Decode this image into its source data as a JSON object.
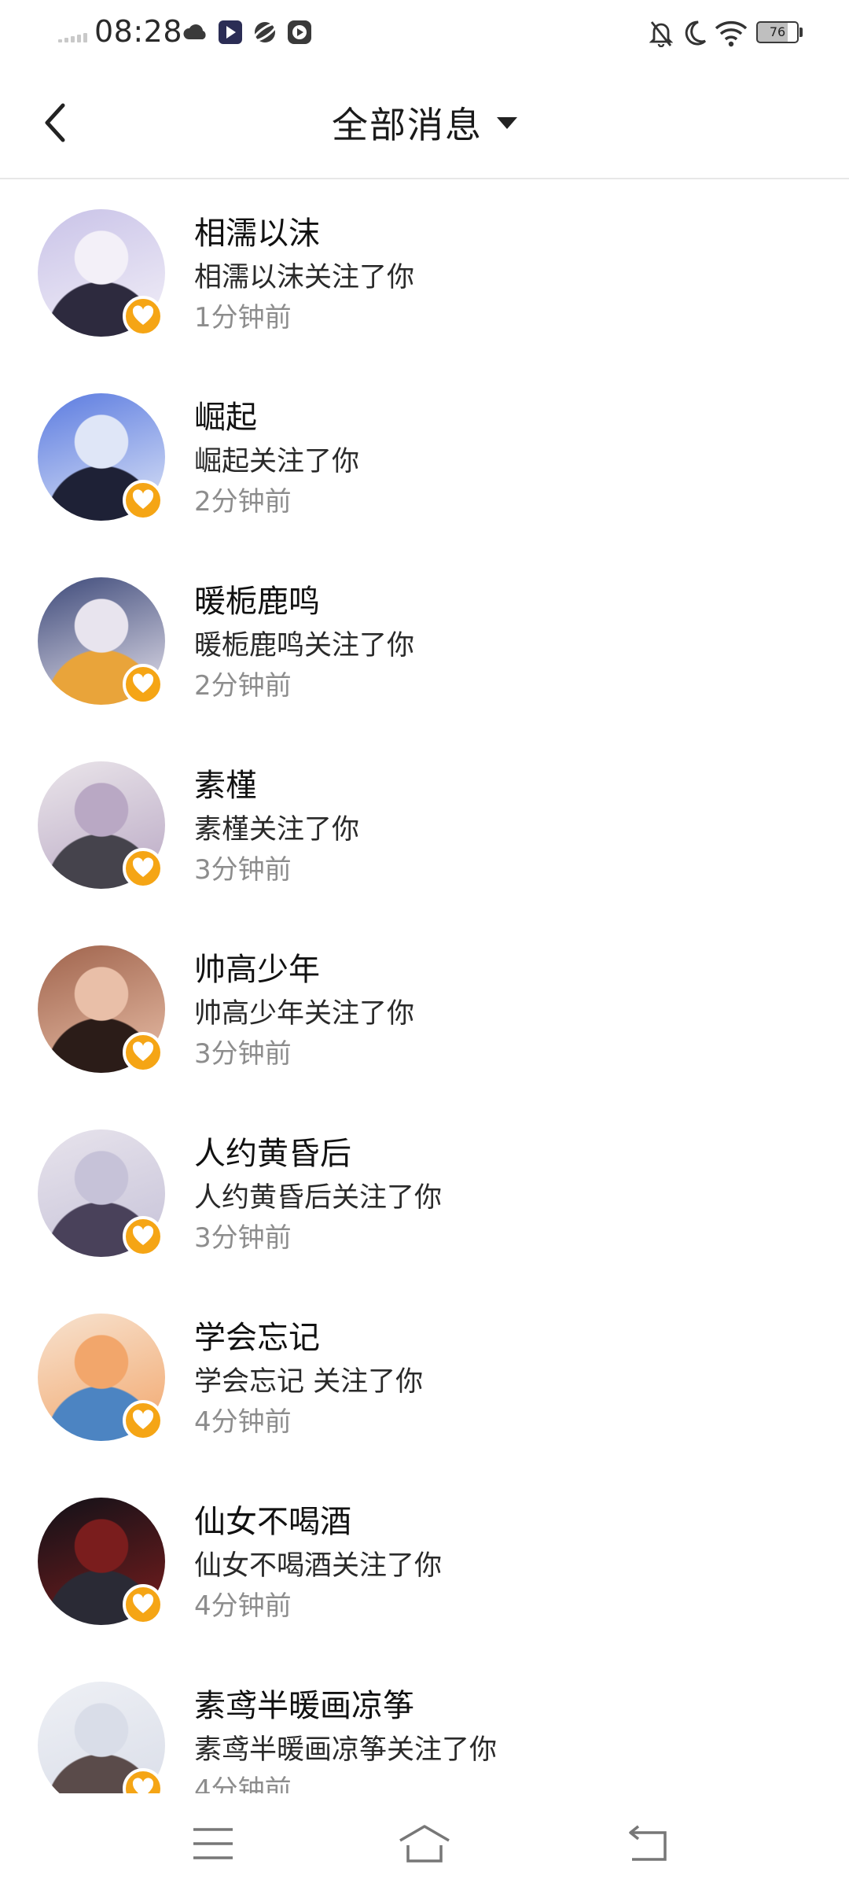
{
  "status_bar": {
    "time": "08:28",
    "battery": "76",
    "icons": [
      "cloud-icon",
      "play-app-icon",
      "planet-app-icon",
      "video-app-icon",
      "bell-off-icon",
      "moon-icon",
      "wifi-icon",
      "battery-icon"
    ]
  },
  "header": {
    "title": "全部消息",
    "back_icon": "chevron-left-icon",
    "dropdown_icon": "caret-down-icon"
  },
  "messages": [
    {
      "name": "相濡以沫",
      "text": "相濡以沫关注了你",
      "time": "1分钟前",
      "colors": [
        "#c9c3e8",
        "#f3f0f8",
        "#2d2a3e"
      ]
    },
    {
      "name": "崛起",
      "text": "崛起关注了你",
      "time": "2分钟前",
      "colors": [
        "#5b7be0",
        "#dfe6f7",
        "#1e2136"
      ]
    },
    {
      "name": "暖栀鹿鸣",
      "text": "暖栀鹿鸣关注了你",
      "time": "2分钟前",
      "colors": [
        "#3e4a7a",
        "#e8e4ee",
        "#e9a43a"
      ]
    },
    {
      "name": "素槿",
      "text": "素槿关注了你",
      "time": "3分钟前",
      "colors": [
        "#eae5ea",
        "#b9a8c4",
        "#45434c"
      ]
    },
    {
      "name": "帅高少年",
      "text": "帅高少年关注了你",
      "time": "3分钟前",
      "colors": [
        "#a0644d",
        "#e9bfa8",
        "#2b1c18"
      ]
    },
    {
      "name": "人约黄昏后",
      "text": "人约黄昏后关注了你",
      "time": "3分钟前",
      "colors": [
        "#e7e3ec",
        "#c6c2d8",
        "#49415a"
      ]
    },
    {
      "name": "学会忘记",
      "text": "学会忘记 关注了你",
      "time": "4分钟前",
      "colors": [
        "#f7e2cf",
        "#f2a66b",
        "#4c84c2"
      ]
    },
    {
      "name": "仙女不喝酒",
      "text": "仙女不喝酒关注了你",
      "time": "4分钟前",
      "colors": [
        "#111118",
        "#7a1d1d",
        "#2a2a35"
      ]
    },
    {
      "name": "素鸢半暖画凉筝",
      "text": "素鸢半暖画凉筝关注了你",
      "time": "4分钟前",
      "colors": [
        "#eef0f5",
        "#d9dde8",
        "#5a4b4a"
      ]
    }
  ],
  "nav_bar": {
    "icons": [
      "menu-icon",
      "home-icon",
      "back-icon"
    ]
  }
}
